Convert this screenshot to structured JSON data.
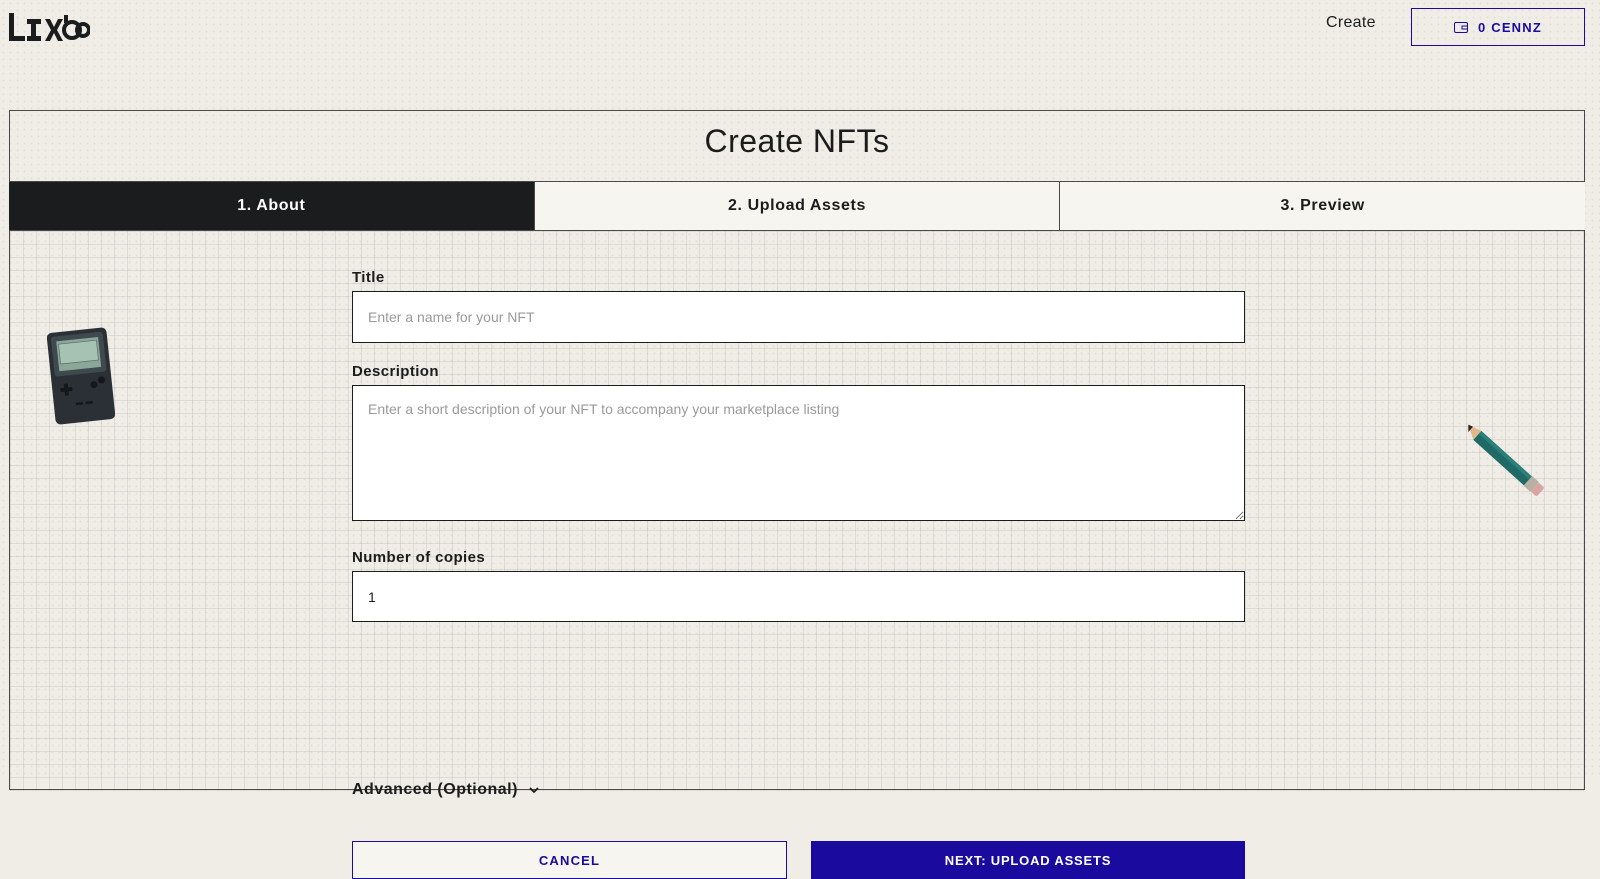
{
  "header": {
    "logo_icon": "lilu-wordmark-logo",
    "nav_create": "Create",
    "wallet": {
      "icon": "wallet-icon",
      "label": "0 CENNZ"
    }
  },
  "panel": {
    "title": "Create NFTs",
    "tabs": [
      {
        "label": "1. About",
        "active": true
      },
      {
        "label": "2. Upload Assets",
        "active": false
      },
      {
        "label": "3. Preview",
        "active": false
      }
    ]
  },
  "form": {
    "title": {
      "label": "Title",
      "placeholder": "Enter a name for your NFT",
      "value": ""
    },
    "description": {
      "label": "Description",
      "placeholder": "Enter a short description of your NFT to accompany your marketplace listing",
      "value": ""
    },
    "copies": {
      "label": "Number of copies",
      "value": "1"
    },
    "advanced": {
      "label": "Advanced (Optional)",
      "icon": "chevron-down-icon"
    },
    "cancel_label": "CANCEL",
    "next_label": "NEXT: UPLOAD ASSETS"
  },
  "decorations": [
    "gameboy-illustration",
    "pencil-illustration"
  ],
  "colors": {
    "accent": "#1a0a9e",
    "dark": "#1b1c1e",
    "background": "#efede6"
  }
}
